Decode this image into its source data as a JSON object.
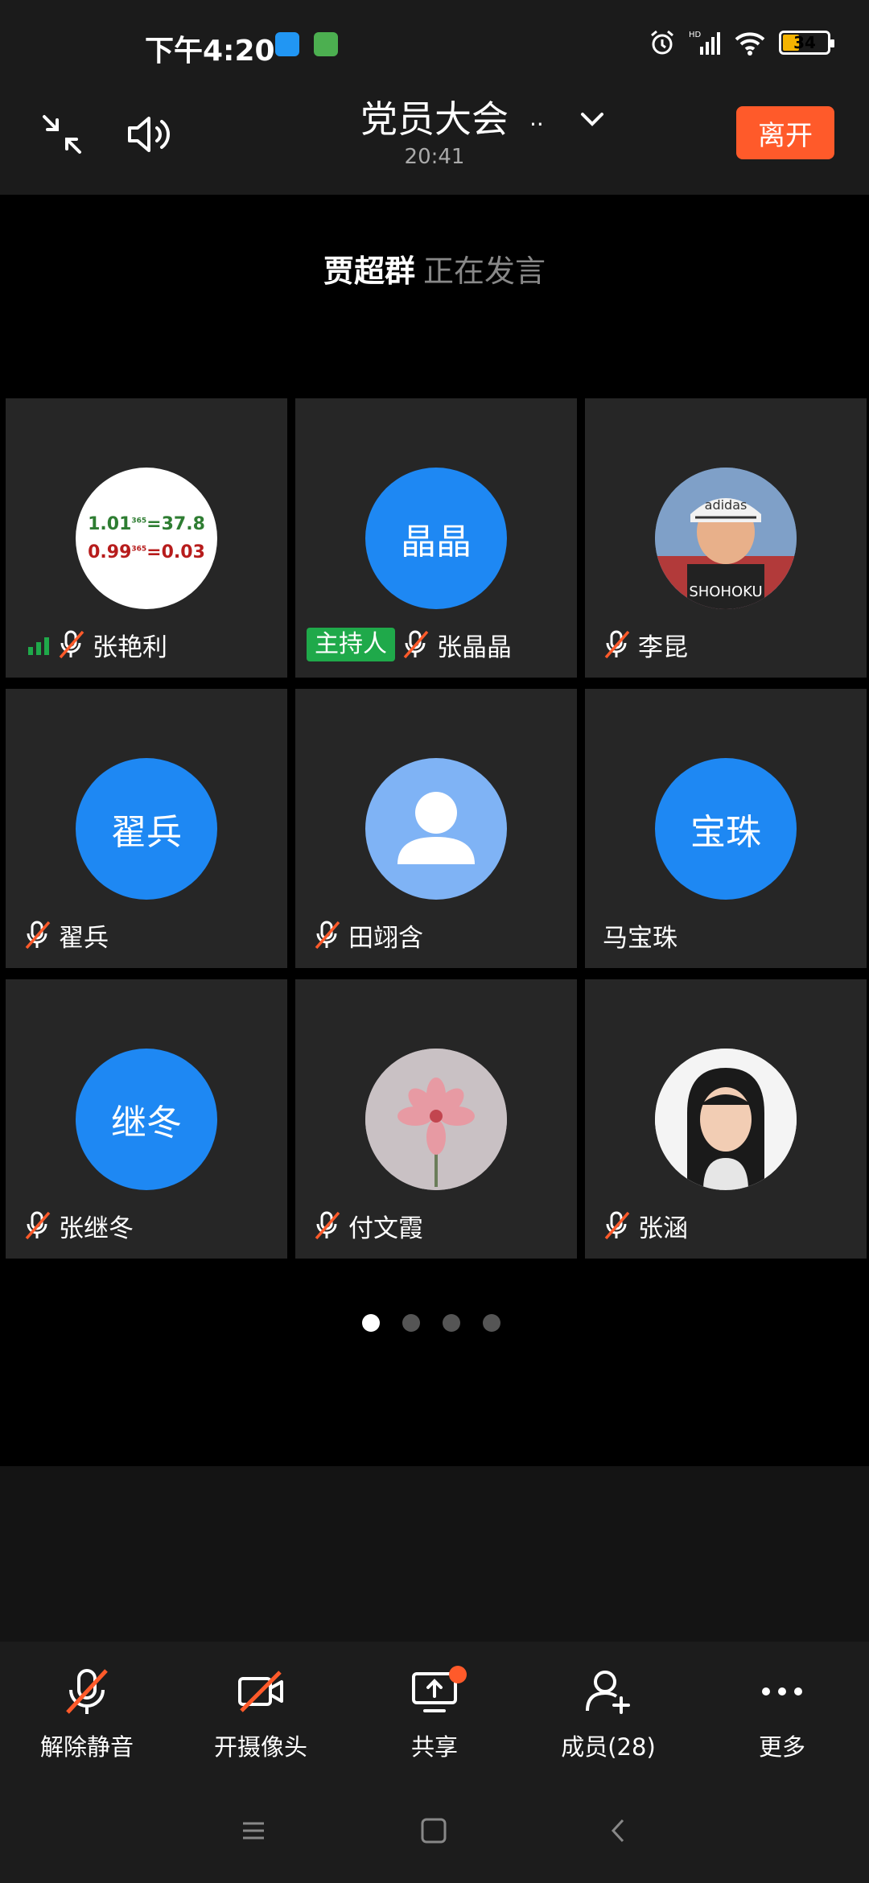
{
  "status_bar": {
    "time": "下午4:20",
    "battery": "34",
    "colors": {
      "battery_fill": "#f5b400",
      "app1": "#2196f3",
      "app2": "#4caf50"
    }
  },
  "header": {
    "title": "党员大会",
    "title_ellipsis": "..",
    "duration": "20:41",
    "leave_label": "离开",
    "icons": [
      "collapse-icon",
      "speaker-icon",
      "chevron-down-icon"
    ]
  },
  "speaker": {
    "name": "贾超群",
    "status": "正在发言"
  },
  "participants": [
    {
      "name": "张艳利",
      "avatar_type": "image",
      "avatar_line1_a": "1.01",
      "avatar_sup1": "365",
      "avatar_line1_b": "=37.8",
      "avatar_line2_a": "0.99",
      "avatar_sup2": "365",
      "avatar_line2_b": "=0.03",
      "muted": true,
      "signal": true
    },
    {
      "name": "张晶晶",
      "avatar_type": "initials",
      "initials": "晶晶",
      "badge": "主持人",
      "muted": true
    },
    {
      "name": "李昆",
      "avatar_type": "photo",
      "muted": true
    },
    {
      "name": "翟兵",
      "avatar_type": "initials",
      "initials": "翟兵",
      "muted": true
    },
    {
      "name": "田翊含",
      "avatar_type": "default",
      "muted": true
    },
    {
      "name": "马宝珠",
      "avatar_type": "initials",
      "initials": "宝珠",
      "muted": false
    },
    {
      "name": "张继冬",
      "avatar_type": "initials",
      "initials": "继冬",
      "muted": true
    },
    {
      "name": "付文霞",
      "avatar_type": "flower",
      "muted": true
    },
    {
      "name": "张涵",
      "avatar_type": "portrait",
      "muted": true
    }
  ],
  "pager": {
    "pages": 4,
    "current": 1
  },
  "toolbar": {
    "unmute": "解除静音",
    "camera": "开摄像头",
    "share": "共享",
    "members": "成员(28)",
    "more": "更多"
  },
  "colors": {
    "accent": "#1e88f3",
    "leave": "#ff5a2a",
    "host_badge": "#1fa94a",
    "mute_slash": "#ff5a2a"
  }
}
